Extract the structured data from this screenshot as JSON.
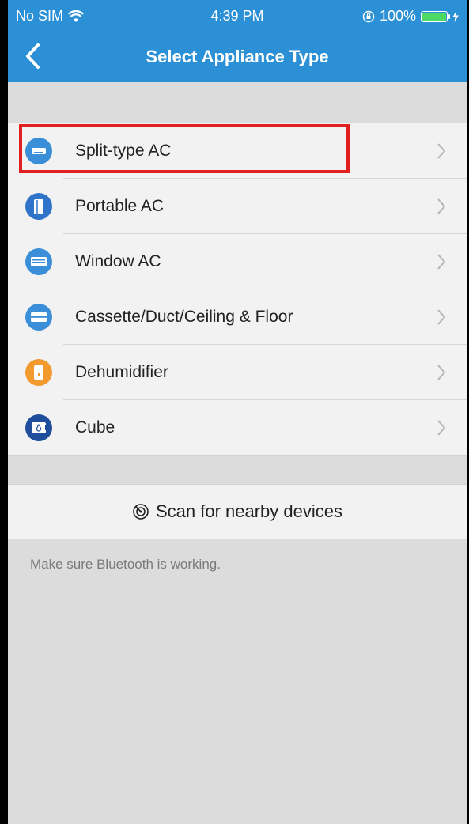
{
  "status_bar": {
    "carrier": "No SIM",
    "time": "4:39 PM",
    "battery": "100%"
  },
  "nav": {
    "title": "Select Appliance Type"
  },
  "appliances": [
    {
      "label": "Split-type AC",
      "icon": "split-ac-icon",
      "color": "#3a8fd8"
    },
    {
      "label": "Portable AC",
      "icon": "portable-ac-icon",
      "color": "#2f74c8"
    },
    {
      "label": "Window AC",
      "icon": "window-ac-icon",
      "color": "#3a8fd8"
    },
    {
      "label": "Cassette/Duct/Ceiling & Floor",
      "icon": "cassette-icon",
      "color": "#3a8fd8"
    },
    {
      "label": "Dehumidifier",
      "icon": "dehumidifier-icon",
      "color": "#f29a2e"
    },
    {
      "label": "Cube",
      "icon": "cube-icon",
      "color": "#1f4e9c"
    }
  ],
  "scan": {
    "label": "Scan for nearby devices",
    "icon": "radar-icon"
  },
  "hint": "Make sure Bluetooth is working.",
  "colors": {
    "accent": "#2c90d6",
    "highlight": "#e02020"
  }
}
